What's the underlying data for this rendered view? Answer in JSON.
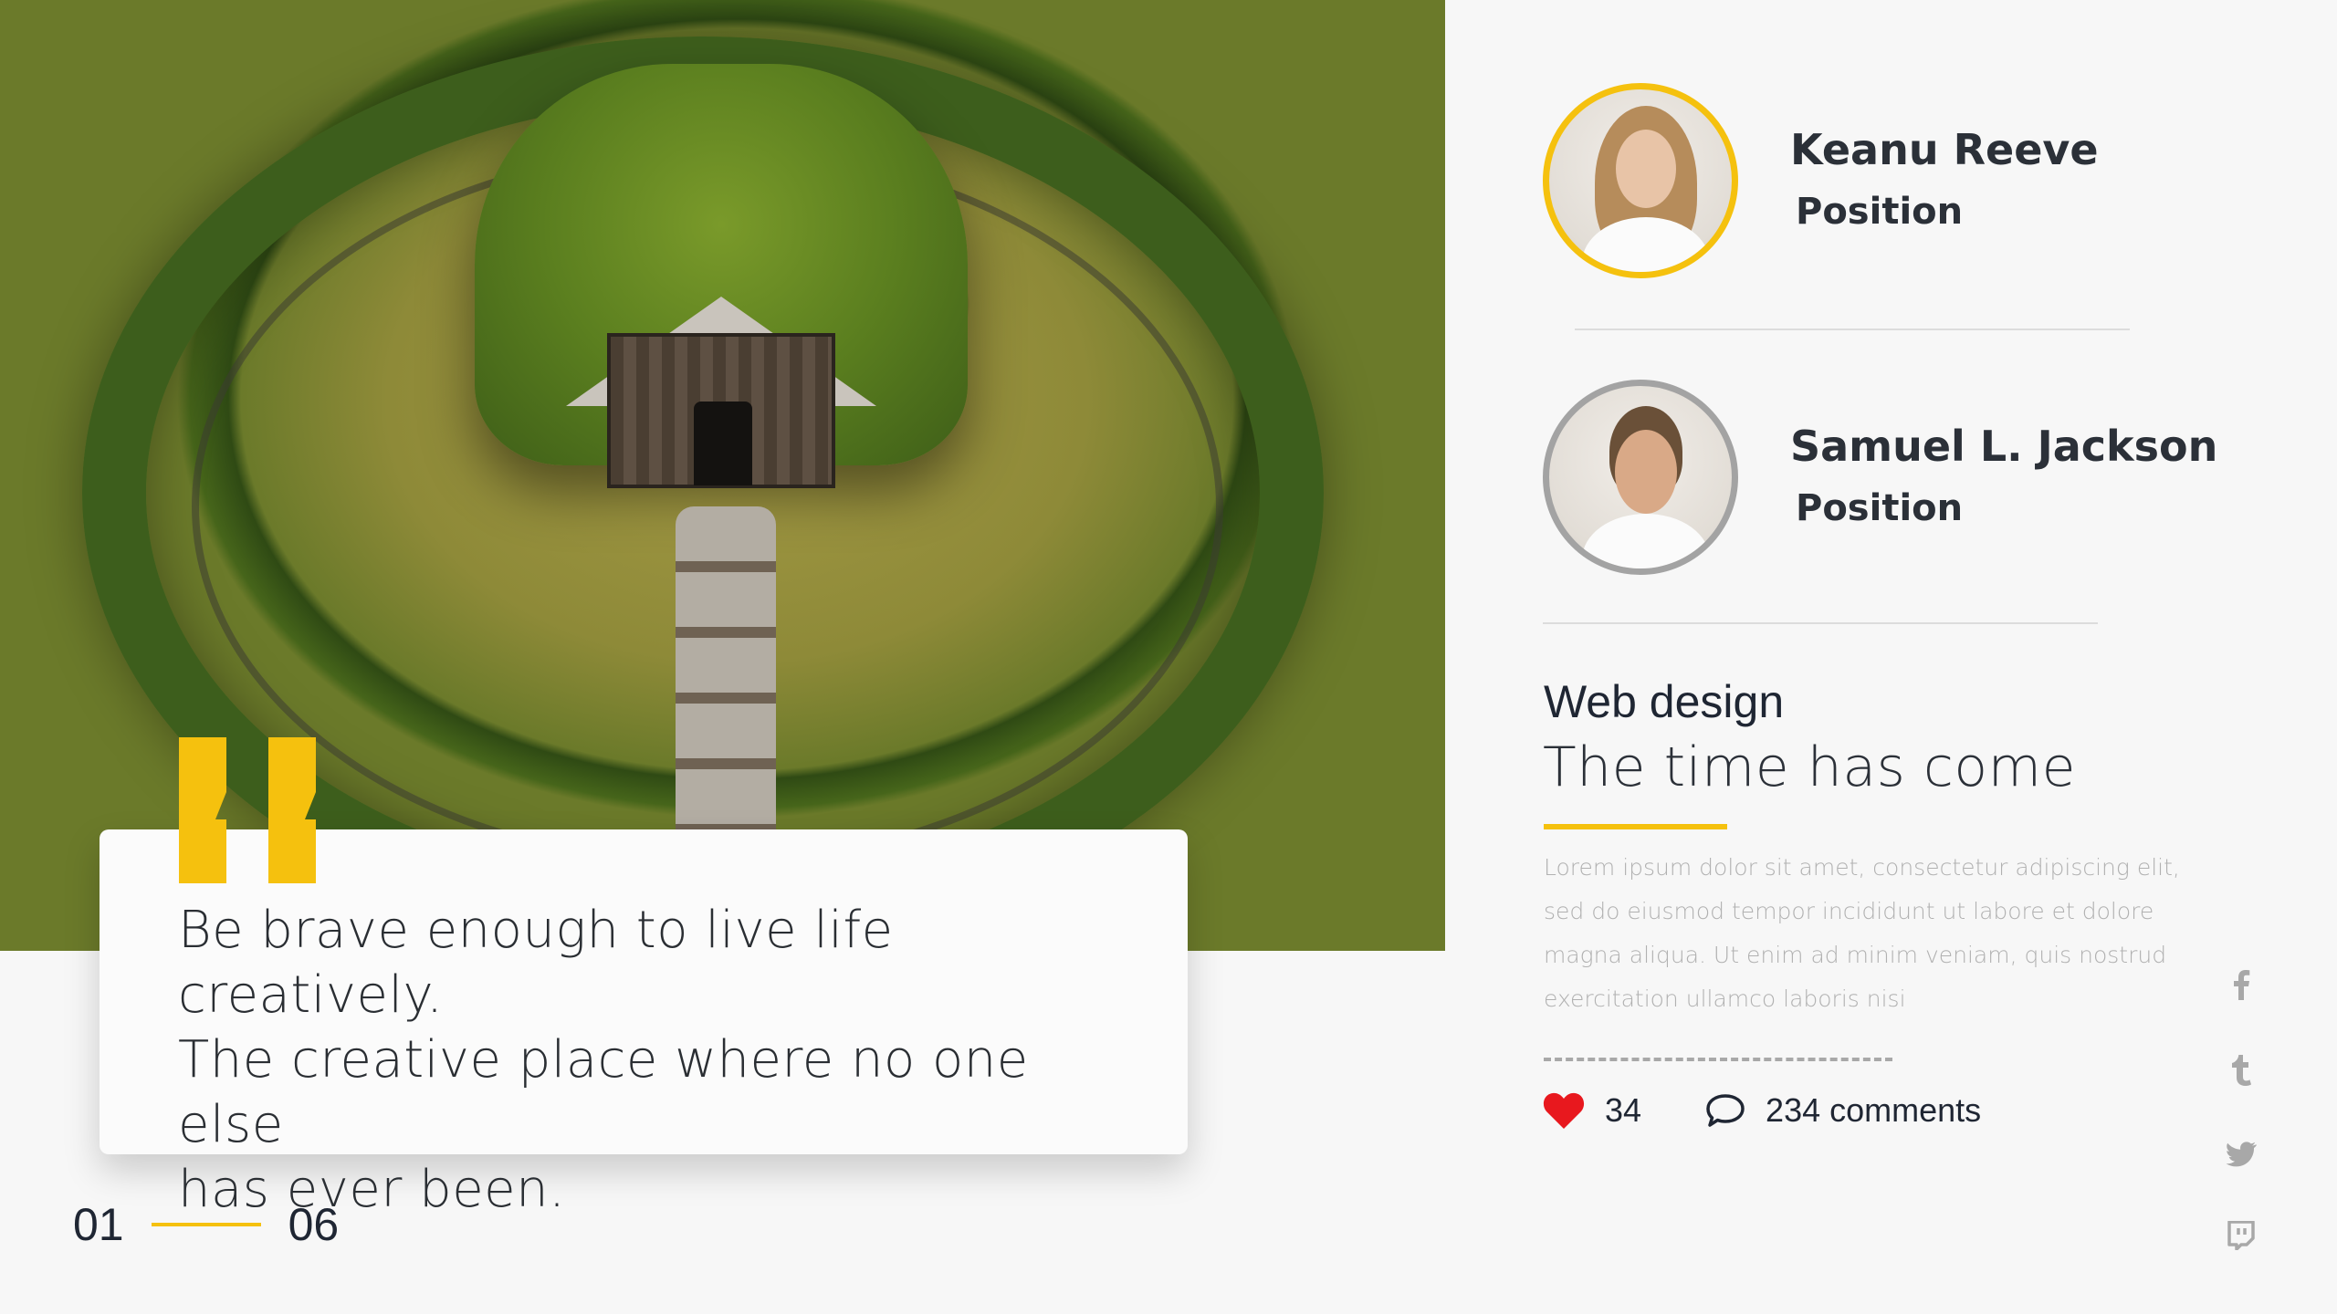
{
  "quote": {
    "text": "Be brave enough to live life creatively.\nThe creative place where no one else\nhas ever been."
  },
  "pager": {
    "current": "01",
    "total": "06"
  },
  "people": [
    {
      "name": "Keanu Reeve",
      "position": "Position"
    },
    {
      "name": "Samuel L. Jackson",
      "position": "Position"
    }
  ],
  "blog": {
    "category": "Web design",
    "title": "The time has come",
    "body": "Lorem ipsum dolor sit amet, consectetur adipiscing elit, sed do eiusmod tempor incididunt ut labore et dolore magna aliqua. Ut enim ad minim veniam, quis nostrud exercitation ullamco laboris nisi",
    "likes": "34",
    "comments": "234 comments"
  },
  "social": [
    "facebook-icon",
    "tumblr-icon",
    "twitter-icon",
    "twitch-icon"
  ],
  "colors": {
    "accent": "#f5c10e",
    "heart": "#e8181e",
    "text": "#2b3038",
    "muted": "#b1b1b1"
  }
}
